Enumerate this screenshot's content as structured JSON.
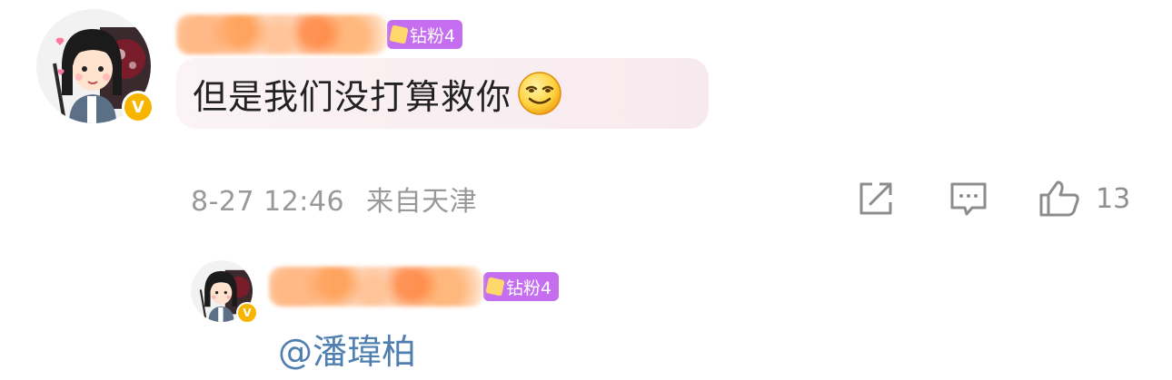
{
  "comment": {
    "fan_badge_label": "钻粉4",
    "text": "但是我们没打算救你",
    "emoji_icon": "smiley-emoji-icon",
    "time": "8-27 12:46",
    "location": "来自天津",
    "actions": {
      "share_icon": "share-icon",
      "comment_icon": "comment-icon",
      "like_icon": "thumbs-up-icon",
      "like_count": "13"
    },
    "verified_label": "V"
  },
  "reply": {
    "fan_badge_label": "钻粉4",
    "mention": "@潘瑋柏",
    "verified_label": "V"
  },
  "colors": {
    "fan_badge": "#c56ef0",
    "verified": "#f7b500",
    "mention": "#4f7fb0",
    "meta_text": "#999999",
    "bubble": "#f8edf0"
  }
}
